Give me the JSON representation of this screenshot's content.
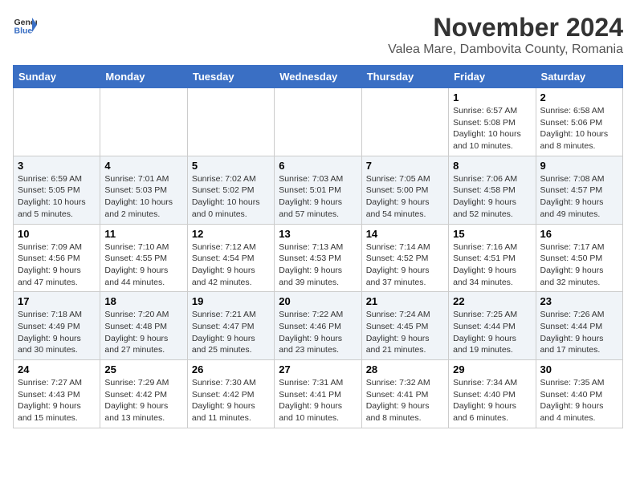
{
  "logo": {
    "general": "General",
    "blue": "Blue"
  },
  "title": "November 2024",
  "subtitle": "Valea Mare, Dambovita County, Romania",
  "days_of_week": [
    "Sunday",
    "Monday",
    "Tuesday",
    "Wednesday",
    "Thursday",
    "Friday",
    "Saturday"
  ],
  "weeks": [
    [
      {
        "day": "",
        "info": ""
      },
      {
        "day": "",
        "info": ""
      },
      {
        "day": "",
        "info": ""
      },
      {
        "day": "",
        "info": ""
      },
      {
        "day": "",
        "info": ""
      },
      {
        "day": "1",
        "info": "Sunrise: 6:57 AM\nSunset: 5:08 PM\nDaylight: 10 hours and 10 minutes."
      },
      {
        "day": "2",
        "info": "Sunrise: 6:58 AM\nSunset: 5:06 PM\nDaylight: 10 hours and 8 minutes."
      }
    ],
    [
      {
        "day": "3",
        "info": "Sunrise: 6:59 AM\nSunset: 5:05 PM\nDaylight: 10 hours and 5 minutes."
      },
      {
        "day": "4",
        "info": "Sunrise: 7:01 AM\nSunset: 5:03 PM\nDaylight: 10 hours and 2 minutes."
      },
      {
        "day": "5",
        "info": "Sunrise: 7:02 AM\nSunset: 5:02 PM\nDaylight: 10 hours and 0 minutes."
      },
      {
        "day": "6",
        "info": "Sunrise: 7:03 AM\nSunset: 5:01 PM\nDaylight: 9 hours and 57 minutes."
      },
      {
        "day": "7",
        "info": "Sunrise: 7:05 AM\nSunset: 5:00 PM\nDaylight: 9 hours and 54 minutes."
      },
      {
        "day": "8",
        "info": "Sunrise: 7:06 AM\nSunset: 4:58 PM\nDaylight: 9 hours and 52 minutes."
      },
      {
        "day": "9",
        "info": "Sunrise: 7:08 AM\nSunset: 4:57 PM\nDaylight: 9 hours and 49 minutes."
      }
    ],
    [
      {
        "day": "10",
        "info": "Sunrise: 7:09 AM\nSunset: 4:56 PM\nDaylight: 9 hours and 47 minutes."
      },
      {
        "day": "11",
        "info": "Sunrise: 7:10 AM\nSunset: 4:55 PM\nDaylight: 9 hours and 44 minutes."
      },
      {
        "day": "12",
        "info": "Sunrise: 7:12 AM\nSunset: 4:54 PM\nDaylight: 9 hours and 42 minutes."
      },
      {
        "day": "13",
        "info": "Sunrise: 7:13 AM\nSunset: 4:53 PM\nDaylight: 9 hours and 39 minutes."
      },
      {
        "day": "14",
        "info": "Sunrise: 7:14 AM\nSunset: 4:52 PM\nDaylight: 9 hours and 37 minutes."
      },
      {
        "day": "15",
        "info": "Sunrise: 7:16 AM\nSunset: 4:51 PM\nDaylight: 9 hours and 34 minutes."
      },
      {
        "day": "16",
        "info": "Sunrise: 7:17 AM\nSunset: 4:50 PM\nDaylight: 9 hours and 32 minutes."
      }
    ],
    [
      {
        "day": "17",
        "info": "Sunrise: 7:18 AM\nSunset: 4:49 PM\nDaylight: 9 hours and 30 minutes."
      },
      {
        "day": "18",
        "info": "Sunrise: 7:20 AM\nSunset: 4:48 PM\nDaylight: 9 hours and 27 minutes."
      },
      {
        "day": "19",
        "info": "Sunrise: 7:21 AM\nSunset: 4:47 PM\nDaylight: 9 hours and 25 minutes."
      },
      {
        "day": "20",
        "info": "Sunrise: 7:22 AM\nSunset: 4:46 PM\nDaylight: 9 hours and 23 minutes."
      },
      {
        "day": "21",
        "info": "Sunrise: 7:24 AM\nSunset: 4:45 PM\nDaylight: 9 hours and 21 minutes."
      },
      {
        "day": "22",
        "info": "Sunrise: 7:25 AM\nSunset: 4:44 PM\nDaylight: 9 hours and 19 minutes."
      },
      {
        "day": "23",
        "info": "Sunrise: 7:26 AM\nSunset: 4:44 PM\nDaylight: 9 hours and 17 minutes."
      }
    ],
    [
      {
        "day": "24",
        "info": "Sunrise: 7:27 AM\nSunset: 4:43 PM\nDaylight: 9 hours and 15 minutes."
      },
      {
        "day": "25",
        "info": "Sunrise: 7:29 AM\nSunset: 4:42 PM\nDaylight: 9 hours and 13 minutes."
      },
      {
        "day": "26",
        "info": "Sunrise: 7:30 AM\nSunset: 4:42 PM\nDaylight: 9 hours and 11 minutes."
      },
      {
        "day": "27",
        "info": "Sunrise: 7:31 AM\nSunset: 4:41 PM\nDaylight: 9 hours and 10 minutes."
      },
      {
        "day": "28",
        "info": "Sunrise: 7:32 AM\nSunset: 4:41 PM\nDaylight: 9 hours and 8 minutes."
      },
      {
        "day": "29",
        "info": "Sunrise: 7:34 AM\nSunset: 4:40 PM\nDaylight: 9 hours and 6 minutes."
      },
      {
        "day": "30",
        "info": "Sunrise: 7:35 AM\nSunset: 4:40 PM\nDaylight: 9 hours and 4 minutes."
      }
    ]
  ]
}
